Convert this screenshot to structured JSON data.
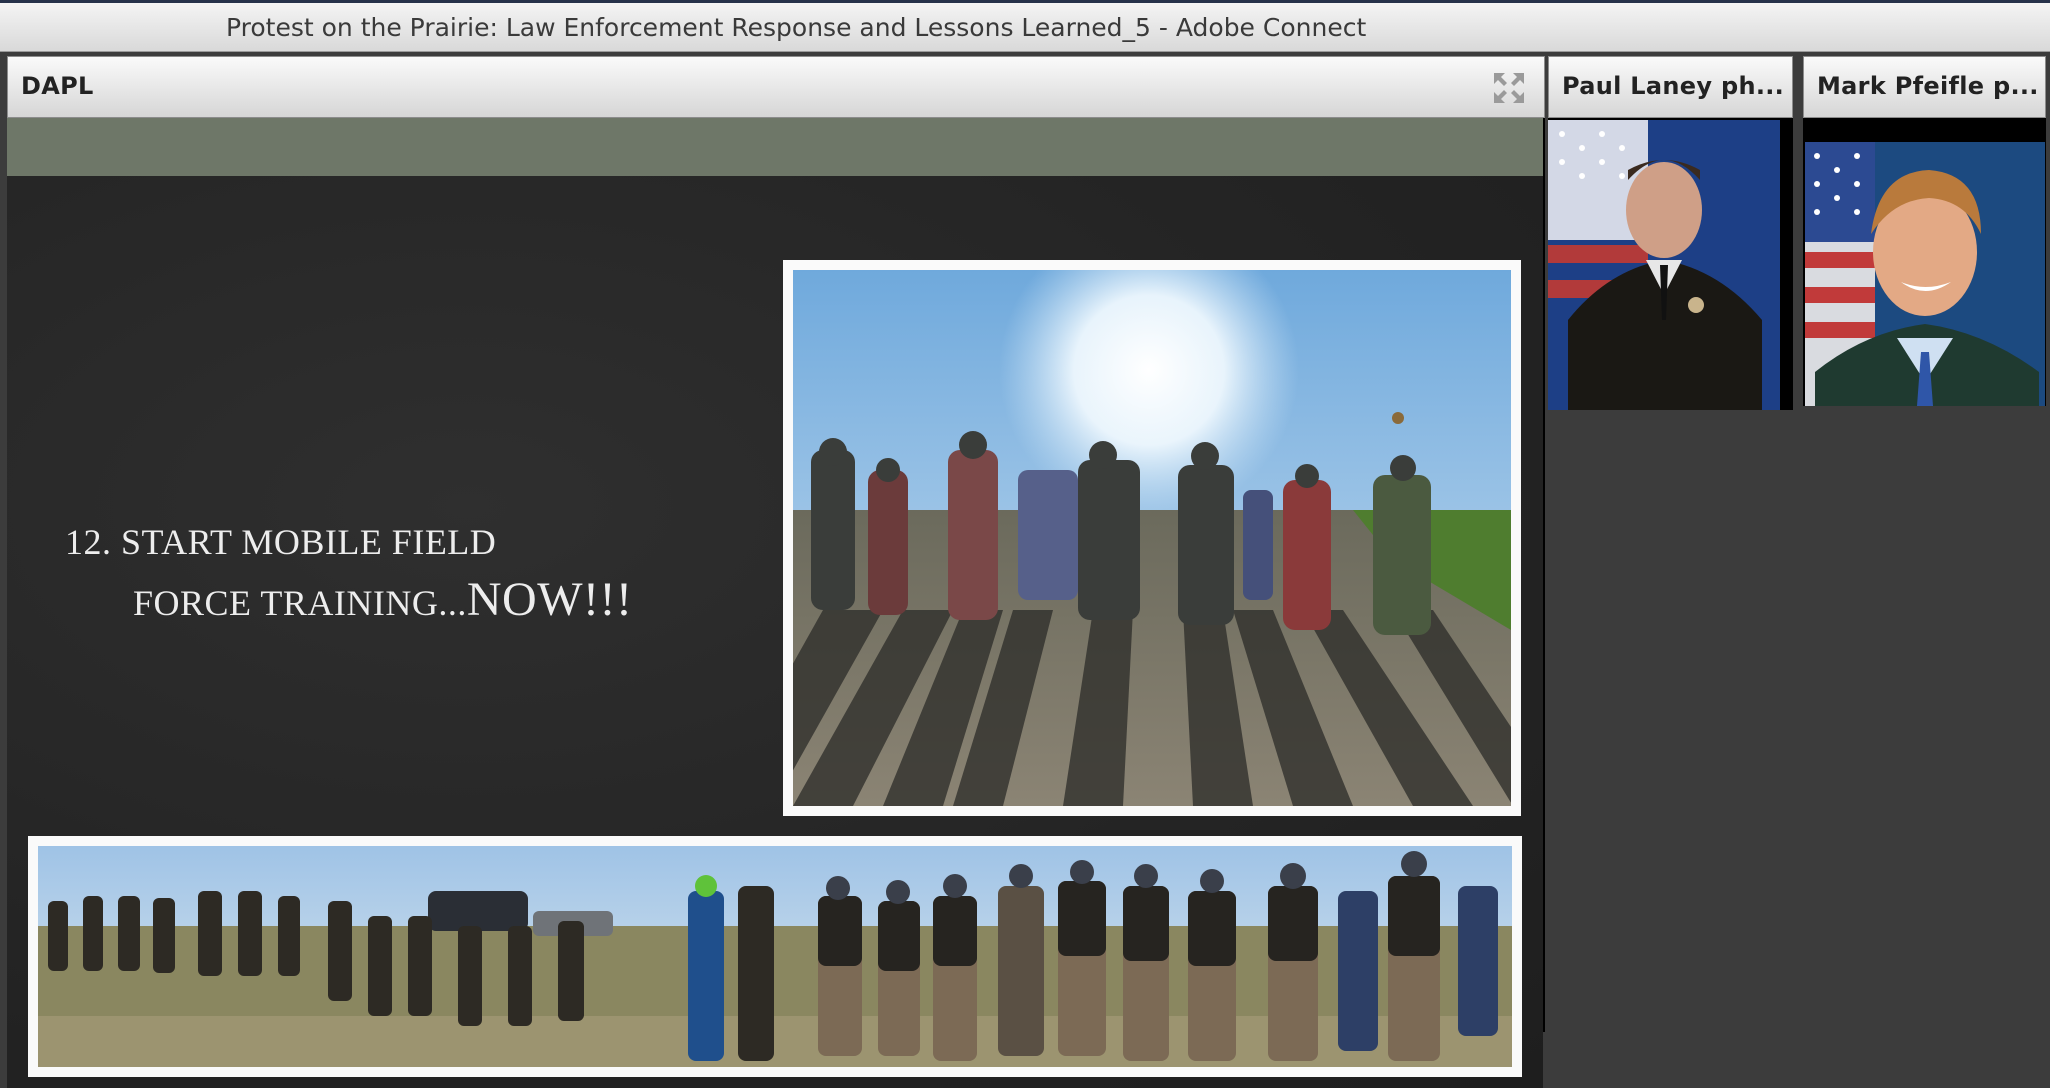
{
  "window": {
    "title": "Protest on the Prairie: Law Enforcement Response and Lessons Learned_5 - Adobe Connect"
  },
  "share_pod": {
    "title": "DAPL",
    "fullscreen_icon": "fullscreen-icon",
    "slide": {
      "heading_line1": "12. START MOBILE FIELD",
      "heading_line2": "FORCE TRAINING...",
      "heading_emphasis": "NOW!!!",
      "photos": [
        "police line on gravel road photo",
        "officers in field panorama photo"
      ]
    }
  },
  "camera_pods": [
    {
      "title": "Paul Laney ph..."
    },
    {
      "title": "Mark Pfeifle p..."
    }
  ],
  "colors": {
    "slide_band": "#6e7768",
    "slide_bg": "#262626",
    "app_bg": "#3c3c3c"
  }
}
